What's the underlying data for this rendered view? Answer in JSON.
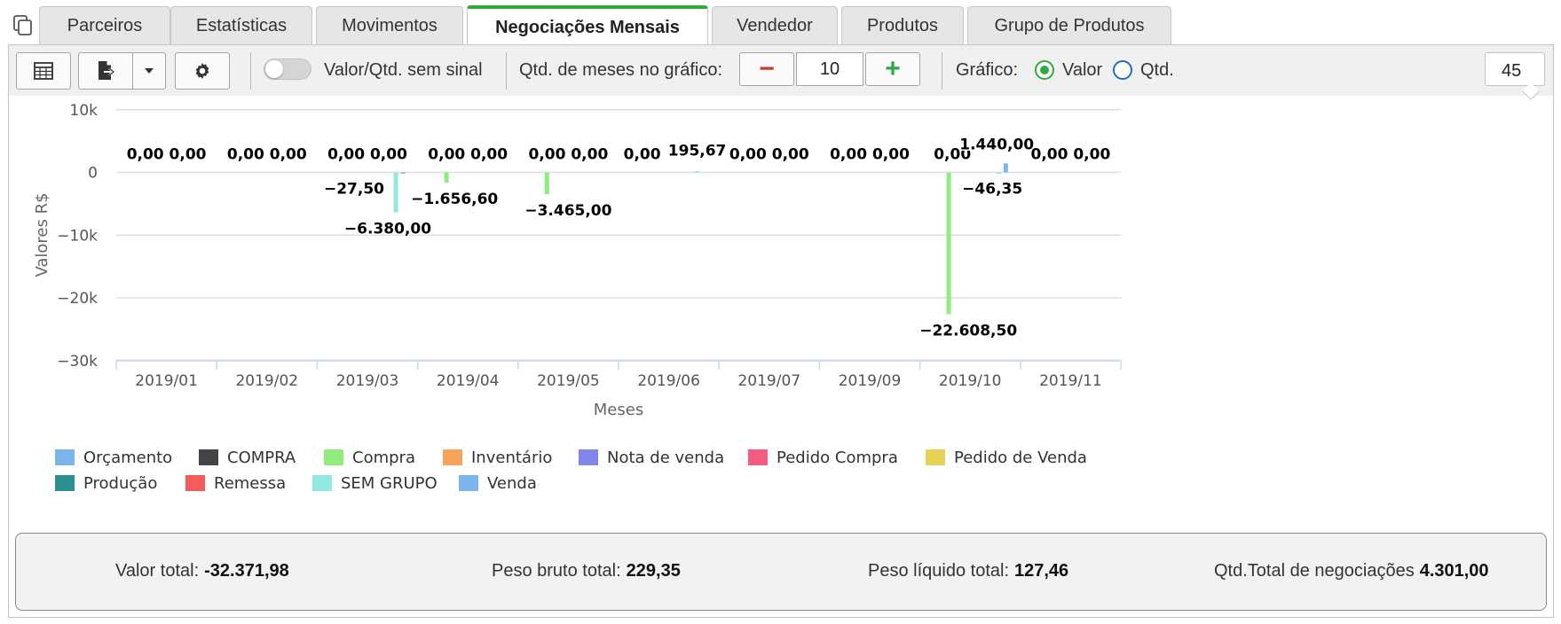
{
  "tabs": [
    {
      "label": "Parceiros"
    },
    {
      "label": "Estatísticas"
    },
    {
      "label": "Movimentos"
    },
    {
      "label": "Negociações Mensais",
      "active": true
    },
    {
      "label": "Vendedor"
    },
    {
      "label": "Produtos"
    },
    {
      "label": "Grupo de Produtos"
    }
  ],
  "toolbar": {
    "table_icon": "table-icon",
    "export_icon": "export-file-icon",
    "settings_icon": "gear-icon",
    "toggle_label": "Valor/Qtd. sem sinal",
    "months_label": "Qtd. de meses no gráfico:",
    "minus": "−",
    "plus": "+",
    "months_value": "10",
    "chart_label": "Gráfico:",
    "radio_value": "Valor",
    "radio_qty": "Qtd.",
    "selected": "Valor",
    "number_box": "45"
  },
  "colors": {
    "accent": "#2eaa3e",
    "minus": "#d9352b",
    "plus": "#2eaa3e",
    "radio": "#1e6fbf"
  },
  "chart_data": {
    "type": "bar",
    "ylabel": "Valores R$",
    "xlabel": "Meses",
    "ylim": [
      -30000,
      10000
    ],
    "yticks": [
      {
        "value": 10000,
        "label": "10k"
      },
      {
        "value": 0,
        "label": "0"
      },
      {
        "value": -10000,
        "label": "−10k"
      },
      {
        "value": -20000,
        "label": "−20k"
      },
      {
        "value": -30000,
        "label": "−30k"
      }
    ],
    "grid": true,
    "categories": [
      "2019/01",
      "2019/02",
      "2019/03",
      "2019/04",
      "2019/05",
      "2019/06",
      "2019/07",
      "2019/09",
      "2019/10",
      "2019/11"
    ],
    "series": [
      {
        "name": "Orçamento",
        "color": "#7cb5ec",
        "values": [
          0,
          0,
          0,
          0,
          0,
          null,
          0,
          0,
          0,
          0
        ]
      },
      {
        "name": "COMPRA",
        "color": "#434348",
        "values": [
          null,
          null,
          null,
          null,
          null,
          null,
          null,
          null,
          null,
          null
        ]
      },
      {
        "name": "Compra",
        "color": "#90ed7d",
        "values": [
          null,
          null,
          null,
          -1656.6,
          -3465.0,
          0,
          null,
          null,
          -22608.5,
          null
        ]
      },
      {
        "name": "Inventário",
        "color": "#f7a35c",
        "values": [
          null,
          null,
          null,
          null,
          null,
          null,
          null,
          null,
          null,
          null
        ]
      },
      {
        "name": "Nota de venda",
        "color": "#8085e9",
        "values": [
          null,
          null,
          null,
          null,
          null,
          null,
          null,
          null,
          null,
          null
        ]
      },
      {
        "name": "Pedido Compra",
        "color": "#f15c80",
        "values": [
          null,
          null,
          null,
          null,
          null,
          null,
          null,
          null,
          null,
          null
        ]
      },
      {
        "name": "Pedido de Venda",
        "color": "#e4d354",
        "values": [
          null,
          null,
          null,
          null,
          null,
          null,
          null,
          null,
          null,
          null
        ]
      },
      {
        "name": "Produção",
        "color": "#2b908f",
        "values": [
          null,
          null,
          null,
          null,
          null,
          null,
          null,
          null,
          null,
          null
        ]
      },
      {
        "name": "Remessa",
        "color": "#f45b5b",
        "values": [
          null,
          null,
          null,
          null,
          null,
          null,
          null,
          null,
          null,
          null
        ]
      },
      {
        "name": "SEM GRUPO",
        "color": "#91e8e1",
        "values": [
          0,
          0,
          -6380.0,
          0,
          0,
          195.67,
          0,
          0,
          -46.35,
          0
        ]
      },
      {
        "name": "Venda",
        "color": "#7cb5ec",
        "values": [
          null,
          null,
          -27.5,
          null,
          null,
          null,
          null,
          null,
          1440.0,
          null
        ]
      }
    ],
    "data_labels": [
      {
        "category": "2019/01",
        "text": "0,00 0,00",
        "value": 0
      },
      {
        "category": "2019/02",
        "text": "0,00 0,00",
        "value": 0
      },
      {
        "category": "2019/03",
        "text": "0,00 0,00",
        "value": 0
      },
      {
        "category": "2019/03",
        "text": "−27,50",
        "value": -27.5
      },
      {
        "category": "2019/03",
        "text": "−6.380,00",
        "value": -6380.0
      },
      {
        "category": "2019/04",
        "text": "0,00 0,00",
        "value": 0
      },
      {
        "category": "2019/04",
        "text": "−1.656,60",
        "value": -1656.6
      },
      {
        "category": "2019/05",
        "text": "0,00 0,00",
        "value": 0
      },
      {
        "category": "2019/05",
        "text": "−3.465,00",
        "value": -3465.0
      },
      {
        "category": "2019/06",
        "text": "0,00",
        "value": 0
      },
      {
        "category": "2019/06",
        "text": "195,67",
        "value": 195.67
      },
      {
        "category": "2019/07",
        "text": "0,00 0,00",
        "value": 0
      },
      {
        "category": "2019/09",
        "text": "0,00 0,00",
        "value": 0
      },
      {
        "category": "2019/10",
        "text": "0,00",
        "value": 0
      },
      {
        "category": "2019/10",
        "text": "1.440,00",
        "value": 1440.0
      },
      {
        "category": "2019/10",
        "text": "−46,35",
        "value": -46.35
      },
      {
        "category": "2019/10",
        "text": "−22.608,50",
        "value": -22608.5
      },
      {
        "category": "2019/11",
        "text": "0,00 0,00",
        "value": 0
      }
    ],
    "legend": [
      "Orçamento",
      "COMPRA",
      "Compra",
      "Inventário",
      "Nota de venda",
      "Pedido Compra",
      "Pedido de Venda",
      "Produção",
      "Remessa",
      "SEM GRUPO",
      "Venda"
    ],
    "legend_position": "bottom-left"
  },
  "summary": {
    "valor_total_label": "Valor total:",
    "valor_total": "-32.371,98",
    "peso_bruto_label": "Peso bruto total:",
    "peso_bruto": "229,35",
    "peso_liquido_label": "Peso líquido total:",
    "peso_liquido": "127,46",
    "qtd_total_label": "Qtd.Total de negociações",
    "qtd_total": "4.301,00"
  }
}
